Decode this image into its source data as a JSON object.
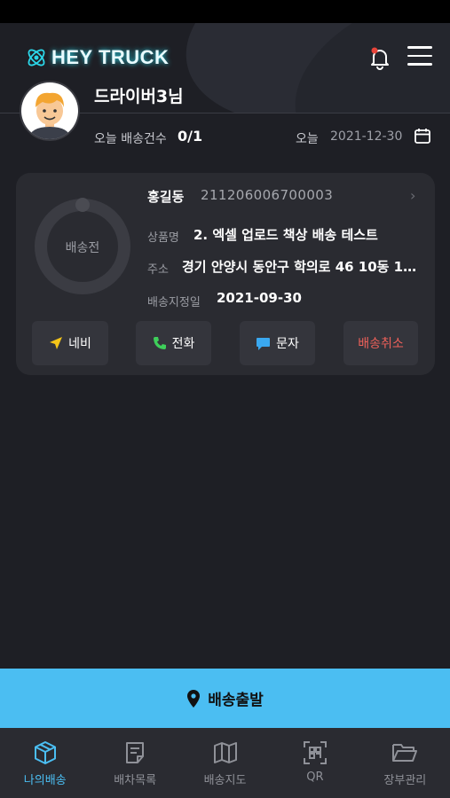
{
  "app": {
    "logo_text": "HEY TRUCK"
  },
  "profile": {
    "driver_name": "드라이버3님"
  },
  "summary": {
    "today_count_label": "오늘 배송건수",
    "today_count_value": "0/1",
    "today_label": "오늘",
    "today_date": "2021-12-30"
  },
  "delivery": {
    "status": "배송전",
    "customer_name": "홍길동",
    "order_no": "211206006700003",
    "product_label": "상품명",
    "product_value": "2. 엑셀 업로드 책상 배송 테스트",
    "address_label": "주소",
    "address_value": "경기 안양시 동안구 학의로 46 10동 1…",
    "date_label": "배송지정일",
    "date_value": "2021-09-30",
    "progress": 0
  },
  "actions": {
    "navi": "네비",
    "call": "전화",
    "sms": "문자",
    "cancel": "배송취소"
  },
  "depart_button": "배송출발",
  "tabs": [
    {
      "label": "나의배송",
      "icon": "box-icon",
      "active": true
    },
    {
      "label": "배차목록",
      "icon": "list-doc-icon"
    },
    {
      "label": "배송지도",
      "icon": "map-icon"
    },
    {
      "label": "QR",
      "icon": "qr-scan-icon"
    },
    {
      "label": "장부관리",
      "icon": "folder-icon"
    }
  ],
  "colors": {
    "accent": "#4bbef2",
    "cancel": "#f0615a",
    "background": "#1e1f25",
    "card": "#2a2b31"
  }
}
